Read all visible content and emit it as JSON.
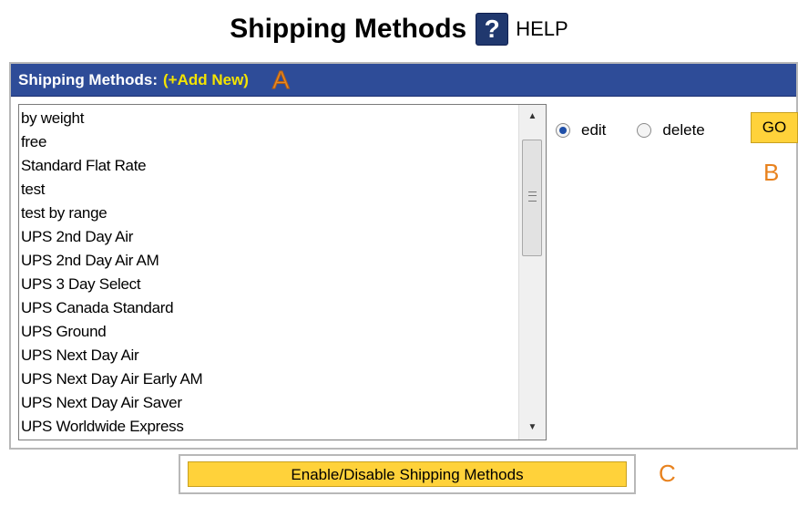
{
  "page": {
    "title": "Shipping Methods",
    "help_glyph": "?",
    "help_label": "HELP"
  },
  "panel": {
    "header_label": "Shipping Methods:",
    "add_new_label": "(+Add New)",
    "marker_a": "A"
  },
  "methods_list": {
    "items": [
      "by weight",
      "free",
      "Standard Flat Rate",
      "test",
      "test by range",
      "UPS 2nd Day Air",
      "UPS 2nd Day Air AM",
      "UPS 3 Day Select",
      "UPS Canada Standard",
      "UPS Ground",
      "UPS Next Day Air",
      "UPS Next Day Air Early AM",
      "UPS Next Day Air Saver",
      "UPS Worldwide Express"
    ]
  },
  "actions": {
    "edit_label": "edit",
    "delete_label": "delete",
    "selected_action": "edit",
    "go_label": "GO",
    "marker_b": "B"
  },
  "footer": {
    "enable_disable_label": "Enable/Disable Shipping Methods",
    "marker_c": "C"
  },
  "colors": {
    "header_bg": "#2e4c98",
    "add_new_link": "#f4e400",
    "button_bg": "#ffd23a",
    "marker": "#e8821e",
    "help_icon_bg": "#20386e"
  },
  "icons": {
    "help": "question-mark-icon",
    "scroll_up": "triangle-up-icon",
    "scroll_down": "triangle-down-icon",
    "scroll_grip": "grip-lines-icon"
  }
}
